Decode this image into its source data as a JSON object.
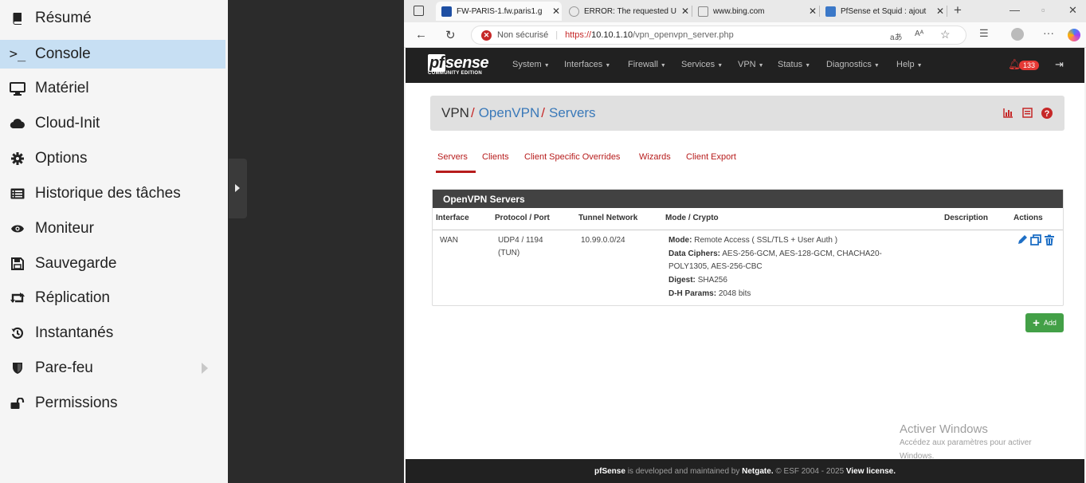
{
  "left_menu": {
    "items": [
      {
        "label": "Résumé",
        "icon": "book-icon"
      },
      {
        "label": "Console",
        "icon": "terminal-icon",
        "active": true
      },
      {
        "label": "Matériel",
        "icon": "monitor-icon"
      },
      {
        "label": "Cloud-Init",
        "icon": "cloud-icon"
      },
      {
        "label": "Options",
        "icon": "gear-icon"
      },
      {
        "label": "Historique des tâches",
        "icon": "list-icon"
      },
      {
        "label": "Moniteur",
        "icon": "eye-icon"
      },
      {
        "label": "Sauvegarde",
        "icon": "floppy-icon"
      },
      {
        "label": "Réplication",
        "icon": "retweet-icon"
      },
      {
        "label": "Instantanés",
        "icon": "history-icon"
      },
      {
        "label": "Pare-feu",
        "icon": "shield-icon"
      },
      {
        "label": "Permissions",
        "icon": "unlock-icon"
      }
    ],
    "console_glyph": ">_"
  },
  "browser": {
    "tabs": [
      {
        "title": "FW-PARIS-1.fw.paris1.g",
        "active": true
      },
      {
        "title": "ERROR: The requested U"
      },
      {
        "title": "www.bing.com"
      },
      {
        "title": "PfSense et Squid : ajout"
      }
    ],
    "security_label": "Non sécurisé",
    "url_scheme": "https://",
    "url_host": "10.10.1.10",
    "url_path": "/vpn_openvpn_server.php",
    "reader_label": "aあ",
    "read_aloud_label": "Aᴬ"
  },
  "pfsense": {
    "logo": "sense",
    "logo_pf": "pf",
    "edition": "COMMUNITY EDITION",
    "menu": [
      "System",
      "Interfaces",
      "Firewall",
      "Services",
      "VPN",
      "Status",
      "Diagnostics",
      "Help"
    ],
    "notification_count": "133",
    "breadcrumb": {
      "root": "VPN",
      "mid": "OpenVPN",
      "current": "Servers",
      "sep": "/"
    },
    "tabs": [
      "Servers",
      "Clients",
      "Client Specific Overrides",
      "Wizards",
      "Client Export"
    ],
    "panel_title": "OpenVPN Servers",
    "columns": [
      "Interface",
      "Protocol / Port",
      "Tunnel Network",
      "Mode / Crypto",
      "Description",
      "Actions"
    ],
    "row": {
      "interface": "WAN",
      "protocol_line1": "UDP4 / 1194",
      "protocol_line2": "(TUN)",
      "tunnel_network": "10.99.0.0/24",
      "mode_label": "Mode:",
      "mode_value": "Remote Access ( SSL/TLS + User Auth )",
      "ciphers_label": "Data Ciphers:",
      "ciphers_value_1": "AES-256-GCM, AES-128-GCM, CHACHA20-",
      "ciphers_value_2": "POLY1305, AES-256-CBC",
      "digest_label": "Digest:",
      "digest_value": "SHA256",
      "dh_label": "D-H Params:",
      "dh_value": "2048 bits",
      "description": ""
    },
    "add_label": "Add",
    "footer": {
      "brand": "pfSense",
      "text1": " is developed and maintained by ",
      "company": "Netgate.",
      "text2": " © ESF 2004 - 2025 ",
      "license": "View license."
    }
  },
  "watermark": {
    "title": "Activer Windows",
    "line1": "Accédez aux paramètres pour activer",
    "line2": "Windows."
  }
}
